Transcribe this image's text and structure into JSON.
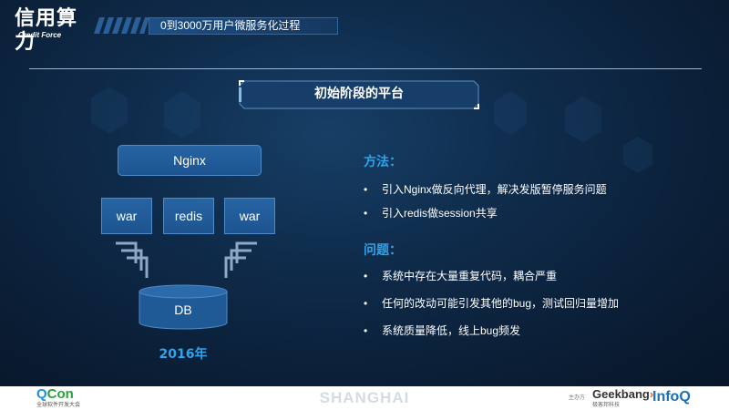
{
  "header": {
    "logo_main": "信用算力",
    "logo_sub": "Credit Force",
    "subtitle": "0到3000万用户微服务化过程"
  },
  "section": {
    "title": "初始阶段的平台"
  },
  "diagram": {
    "nginx": "Nginx",
    "app_servers": [
      "war",
      "redis",
      "war"
    ],
    "database": "DB",
    "year": "2016年"
  },
  "method": {
    "heading": "方法：",
    "items": [
      "引入Nginx做反向代理，解决发版暂停服务问题",
      "引入redis做session共享"
    ]
  },
  "problems": {
    "heading": "问题：",
    "items": [
      "系统中存在大量重复代码，耦合严重",
      "任何的改动可能引发其他的bug，测试回归量增加",
      "系统质量降低，线上bug频发"
    ]
  },
  "bullet_symbol": "•",
  "footer": {
    "qcon_q": "Q",
    "qcon_con": "Con",
    "qcon_sub": "全球软件开发大会",
    "city": "SHANGHAI",
    "organizer_tag": "主办方",
    "geekbang_main": "Geekbang",
    "geekbang_x": "›",
    "geekbang_sub": "极客邦科技",
    "infoq": "InfoQ"
  },
  "colors": {
    "accent": "#2fa3ec",
    "box_fill": "#2764a3",
    "box_border": "#4f8bc8",
    "background": "#0f2c4c"
  },
  "icons": [
    "down-right-chevrons-icon",
    "down-left-chevrons-icon",
    "database-cylinder-icon"
  ]
}
